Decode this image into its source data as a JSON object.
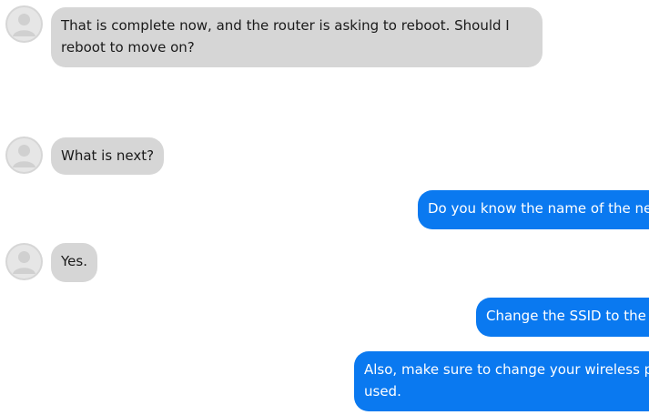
{
  "messages": [
    {
      "sender": "user",
      "text": "That is complete now, and the router is asking to reboot. Should I reboot to move on?"
    },
    {
      "sender": "user",
      "text": "What is next?"
    },
    {
      "sender": "agent",
      "text": "Do you know the name of the netw"
    },
    {
      "sender": "user",
      "text": "Yes."
    },
    {
      "sender": "agent",
      "text": "Change the SSID to the p"
    },
    {
      "sender": "agent",
      "line1": "Also, make sure to change your wireless pass",
      "line2": "used."
    }
  ],
  "colors": {
    "incoming_bubble": "#d6d6d6",
    "outgoing_bubble": "#0a79f0",
    "avatar": "#d6d6d6"
  },
  "icons": {
    "avatar": "user-avatar-icon"
  }
}
